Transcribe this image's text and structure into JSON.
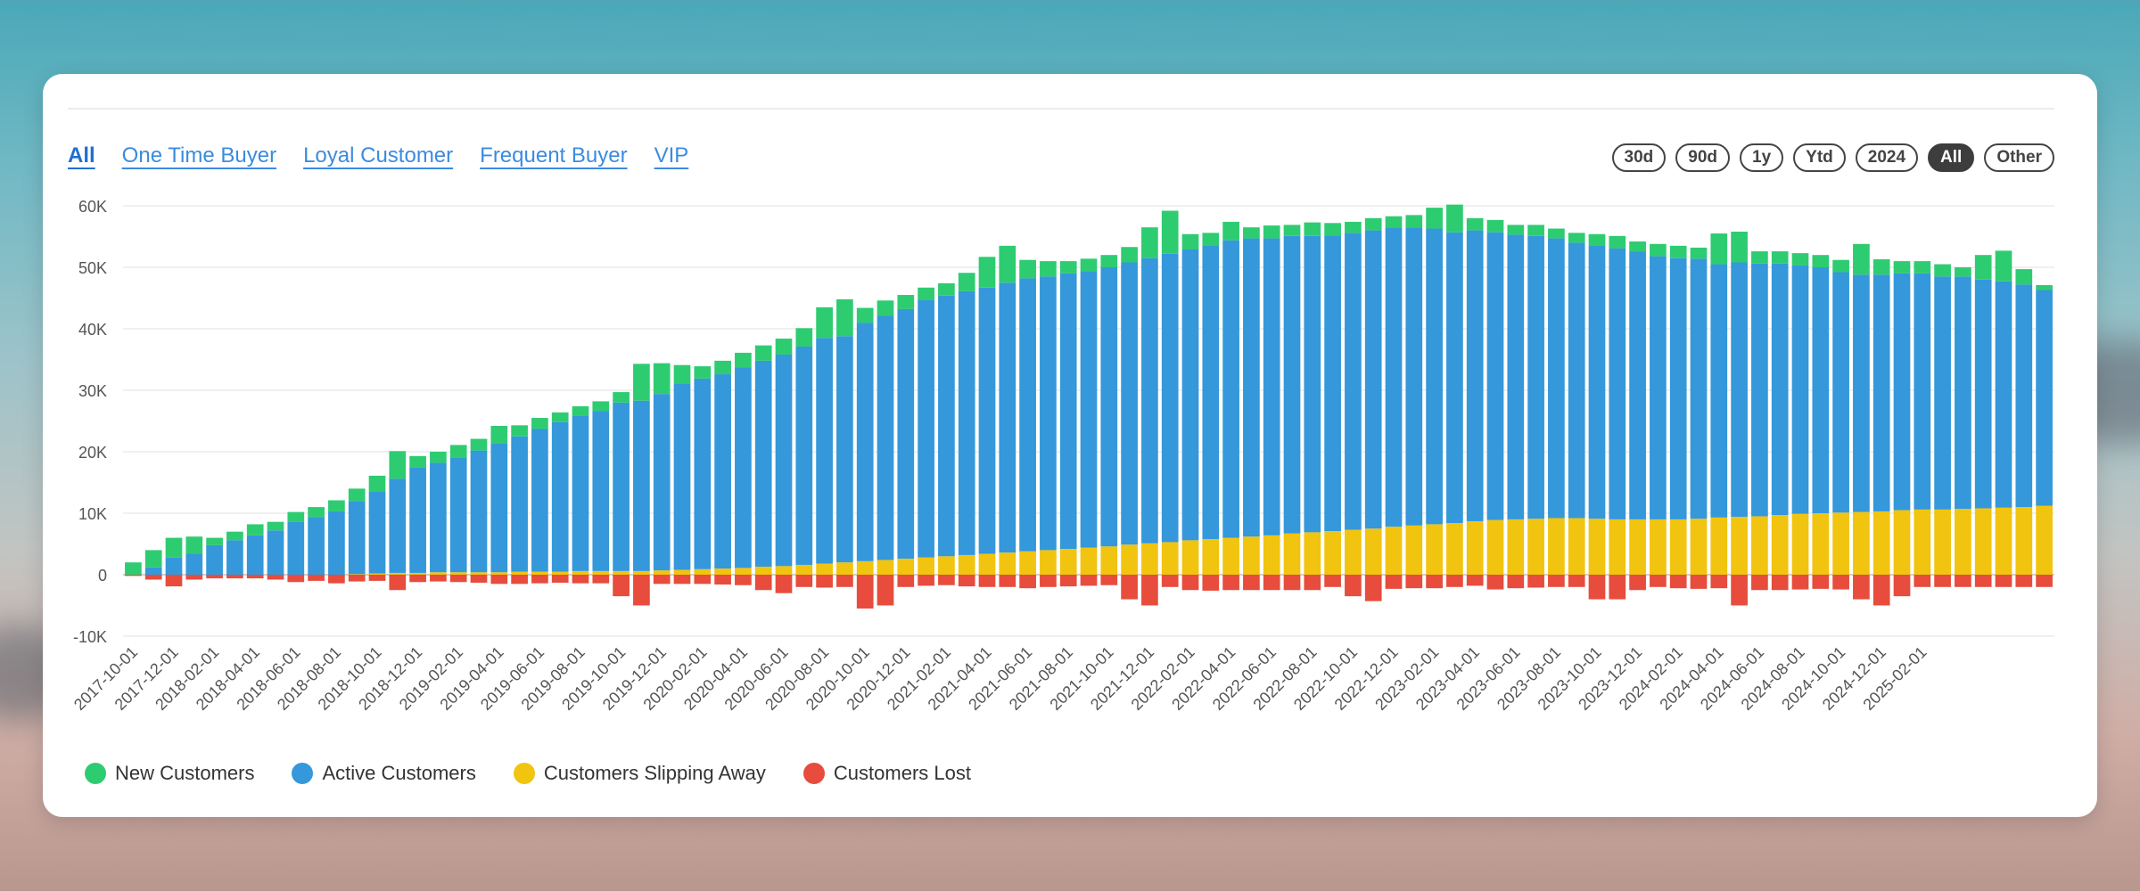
{
  "tabs": [
    {
      "label": "All",
      "active": true
    },
    {
      "label": "One Time Buyer",
      "active": false
    },
    {
      "label": "Loyal Customer",
      "active": false
    },
    {
      "label": "Frequent Buyer",
      "active": false
    },
    {
      "label": "VIP",
      "active": false
    }
  ],
  "ranges": [
    {
      "label": "30d",
      "active": false
    },
    {
      "label": "90d",
      "active": false
    },
    {
      "label": "1y",
      "active": false
    },
    {
      "label": "Ytd",
      "active": false
    },
    {
      "label": "2024",
      "active": false
    },
    {
      "label": "All",
      "active": true
    },
    {
      "label": "Other",
      "active": false
    }
  ],
  "chart_data": {
    "type": "bar",
    "stacked": true,
    "ylim": [
      -10000,
      60000
    ],
    "yticks": [
      -10000,
      0,
      10000,
      20000,
      30000,
      40000,
      50000,
      60000
    ],
    "ytick_labels": [
      "-10K",
      "0",
      "10K",
      "20K",
      "30K",
      "40K",
      "50K",
      "60K"
    ],
    "grid": true,
    "legend_position": "bottom-left",
    "start_month": "2017-10",
    "xtick_labels": [
      "2017-10-01",
      "2017-12-01",
      "2018-02-01",
      "2018-04-01",
      "2018-06-01",
      "2018-08-01",
      "2018-10-01",
      "2018-12-01",
      "2019-02-01",
      "2019-04-01",
      "2019-06-01",
      "2019-08-01",
      "2019-10-01",
      "2019-12-01",
      "2020-02-01",
      "2020-04-01",
      "2020-06-01",
      "2020-08-01",
      "2020-10-01",
      "2020-12-01",
      "2021-02-01",
      "2021-04-01",
      "2021-06-01",
      "2021-08-01",
      "2021-10-01",
      "2021-12-01",
      "2022-02-01",
      "2022-04-01",
      "2022-06-01",
      "2022-08-01",
      "2022-10-01",
      "2022-12-01",
      "2023-02-01",
      "2023-04-01",
      "2023-06-01",
      "2023-08-01",
      "2023-10-01",
      "2023-12-01",
      "2024-02-01",
      "2024-04-01",
      "2024-06-01",
      "2024-08-01",
      "2024-10-01",
      "2024-12-01",
      "2025-02-01"
    ],
    "series": [
      {
        "name": "New Customers",
        "color": "#2ecc71",
        "values": [
          2000,
          2800,
          3200,
          2800,
          1200,
          1400,
          1800,
          1400,
          1600,
          1600,
          1800,
          2000,
          2500,
          4500,
          1800,
          1800,
          2000,
          1900,
          2800,
          1800,
          1800,
          1600,
          1600,
          1600,
          1700,
          6000,
          5000,
          3000,
          2000,
          2200,
          2400,
          2500,
          2600,
          3000,
          5000,
          6000,
          2400,
          2500,
          2300,
          2000,
          2000,
          3000,
          5000,
          6000,
          3000,
          2500,
          2000,
          2000,
          2000,
          2500,
          5000,
          7000,
          2500,
          2000,
          3000,
          1800,
          2100,
          1800,
          2200,
          2000,
          1800,
          2000,
          1800,
          2000,
          3400,
          4500,
          2000,
          2000,
          1600,
          1800,
          1600,
          1600,
          1800,
          2000,
          1600,
          2000,
          2000,
          1800,
          5000,
          5000,
          2000,
          2000,
          2000,
          2000,
          2000,
          5000,
          2500,
          2000,
          2000,
          2000,
          1500,
          4000,
          5000,
          2500,
          800
        ]
      },
      {
        "name": "Active Customers",
        "color": "#3498db",
        "values": [
          0,
          1200,
          2800,
          3400,
          4800,
          5600,
          6400,
          7200,
          8600,
          9400,
          10300,
          11900,
          13400,
          15300,
          17200,
          17800,
          18700,
          19800,
          21000,
          22000,
          23200,
          24300,
          25200,
          26000,
          27400,
          27700,
          28700,
          30300,
          31000,
          31600,
          32600,
          33500,
          34400,
          35500,
          36700,
          36800,
          38800,
          39700,
          40600,
          41900,
          42400,
          42900,
          43300,
          43900,
          44400,
          44500,
          44800,
          45000,
          45400,
          45900,
          46400,
          46900,
          47300,
          47800,
          48400,
          48500,
          48300,
          48400,
          48200,
          48100,
          48300,
          48500,
          48700,
          48500,
          48100,
          47300,
          47300,
          46800,
          46300,
          46000,
          45500,
          44800,
          44500,
          44100,
          43600,
          42800,
          42500,
          42300,
          41200,
          41400,
          41100,
          40900,
          40400,
          40000,
          39100,
          38600,
          38500,
          38500,
          38400,
          37900,
          37800,
          37200,
          36800,
          36200,
          35100
        ]
      },
      {
        "name": "Customers Slipping Away",
        "color": "#f1c40f",
        "values": [
          0,
          0,
          0,
          0,
          0,
          0,
          0,
          0,
          0,
          0,
          0,
          100,
          200,
          300,
          300,
          400,
          400,
          400,
          400,
          500,
          500,
          500,
          600,
          600,
          600,
          600,
          700,
          800,
          900,
          1000,
          1100,
          1300,
          1400,
          1600,
          1800,
          2000,
          2200,
          2400,
          2600,
          2800,
          3000,
          3200,
          3400,
          3600,
          3800,
          4000,
          4200,
          4400,
          4600,
          4900,
          5100,
          5300,
          5600,
          5800,
          6000,
          6200,
          6400,
          6700,
          6900,
          7100,
          7300,
          7500,
          7800,
          8000,
          8200,
          8400,
          8700,
          8900,
          9000,
          9100,
          9200,
          9200,
          9100,
          9000,
          9000,
          9000,
          9000,
          9100,
          9300,
          9400,
          9500,
          9700,
          9900,
          10000,
          10100,
          10200,
          10300,
          10500,
          10600,
          10600,
          10700,
          10800,
          10900,
          11000,
          11200
        ]
      },
      {
        "name": "Customers Lost",
        "color": "#e74c3c",
        "values": [
          -200,
          -800,
          -1900,
          -800,
          -600,
          -600,
          -600,
          -800,
          -1200,
          -1000,
          -1400,
          -1100,
          -1000,
          -2500,
          -1200,
          -1100,
          -1200,
          -1300,
          -1500,
          -1500,
          -1400,
          -1300,
          -1400,
          -1400,
          -3500,
          -5000,
          -1500,
          -1500,
          -1500,
          -1600,
          -1700,
          -2500,
          -3000,
          -2000,
          -2100,
          -2000,
          -5500,
          -5000,
          -2000,
          -1800,
          -1700,
          -1900,
          -2000,
          -2000,
          -2200,
          -2000,
          -1900,
          -1800,
          -1700,
          -4000,
          -5000,
          -2000,
          -2500,
          -2600,
          -2500,
          -2500,
          -2500,
          -2500,
          -2500,
          -2000,
          -3500,
          -4300,
          -2300,
          -2200,
          -2200,
          -2000,
          -1800,
          -2400,
          -2200,
          -2100,
          -2000,
          -2000,
          -4000,
          -4000,
          -2500,
          -2000,
          -2200,
          -2300,
          -2200,
          -5000,
          -2500,
          -2500,
          -2400,
          -2300,
          -2400,
          -4000,
          -5000,
          -3500,
          -2000,
          -2000,
          -2000,
          -2000,
          -2000,
          -2000,
          -2000
        ]
      }
    ]
  }
}
